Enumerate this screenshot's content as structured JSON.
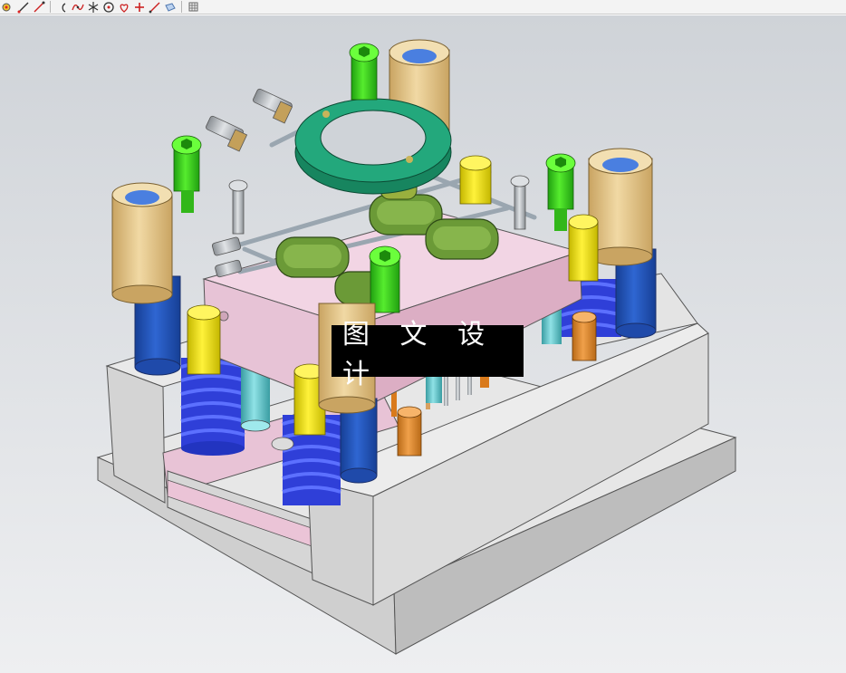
{
  "toolbar": {
    "tools": [
      {
        "icon": "point-icon"
      },
      {
        "icon": "line-icon"
      },
      {
        "icon": "arrow-line-icon"
      },
      {
        "icon": "arc-icon"
      },
      {
        "icon": "curve-icon"
      },
      {
        "icon": "intersection-icon"
      },
      {
        "icon": "circle-icon"
      },
      {
        "icon": "heart-curve-icon"
      },
      {
        "icon": "plus-icon"
      },
      {
        "icon": "arrow-line-2-icon"
      },
      {
        "icon": "plane-icon"
      },
      {
        "icon": "grid-icon"
      }
    ]
  },
  "viewport": {
    "watermark": "图 文 设 计",
    "colors": {
      "background_top": "#cfd3d8",
      "background_bottom": "#eeeff1",
      "plate_gray": "#d9d9d9",
      "pink_plate": "#ecc6d9",
      "green_ring": "#1fa07a",
      "olive_insert": "#5c8a2e",
      "tan_bushing": "#e8c98a",
      "blue_pillar": "#2355b8",
      "lime_screw": "#39d11c",
      "yellow_pin": "#f2e411",
      "orange_pin": "#e38a28",
      "teal_spring": "#5dc7cc"
    }
  }
}
